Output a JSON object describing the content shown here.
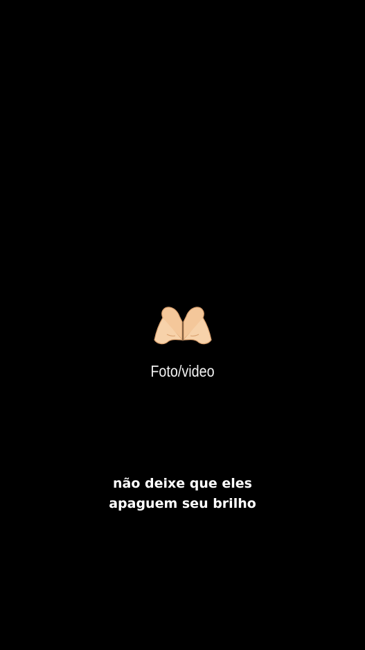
{
  "background_color": "#000000",
  "media": {
    "icon": "heart-hands-emoji",
    "label": "Foto/video"
  },
  "caption": {
    "line1": "não deixe que eles",
    "line2": "apaguem seu brilho"
  }
}
